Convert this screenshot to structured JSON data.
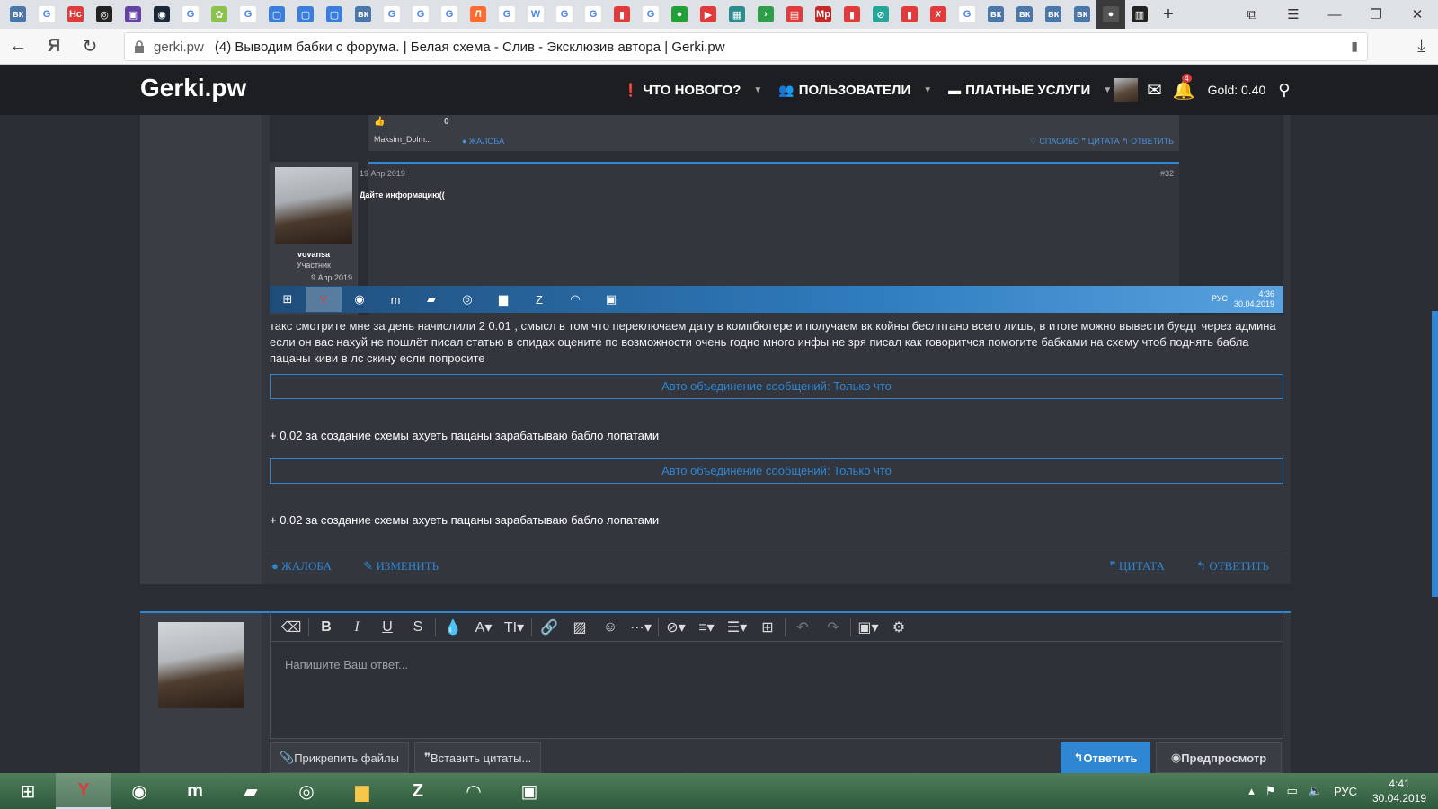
{
  "browser": {
    "tabs": [
      {
        "icon": "vk-icon",
        "glyph": "вк",
        "color": "#4a76a8"
      },
      {
        "icon": "google-icon",
        "glyph": "G",
        "color": "#ffffff"
      },
      {
        "icon": "hc-icon",
        "glyph": "Hc",
        "color": "#e03a3a"
      },
      {
        "icon": "instagram-icon",
        "glyph": "◎",
        "color": "#222222"
      },
      {
        "icon": "twitch-icon",
        "glyph": "▣",
        "color": "#6441a5"
      },
      {
        "icon": "steam-icon",
        "glyph": "◉",
        "color": "#1b2838"
      },
      {
        "icon": "google-icon",
        "glyph": "G",
        "color": "#ffffff"
      },
      {
        "icon": "flower-icon",
        "glyph": "✿",
        "color": "#8bc34a"
      },
      {
        "icon": "google-icon",
        "glyph": "G",
        "color": "#ffffff"
      },
      {
        "icon": "chat-icon",
        "glyph": "▢",
        "color": "#3b7ddd"
      },
      {
        "icon": "chat-icon",
        "glyph": "▢",
        "color": "#3b7ddd"
      },
      {
        "icon": "chat-icon",
        "glyph": "▢",
        "color": "#3b7ddd"
      },
      {
        "icon": "vk-icon",
        "glyph": "вк",
        "color": "#4a76a8"
      },
      {
        "icon": "google-icon",
        "glyph": "G",
        "color": "#ffffff"
      },
      {
        "icon": "google-icon",
        "glyph": "G",
        "color": "#ffffff"
      },
      {
        "icon": "google-icon",
        "glyph": "G",
        "color": "#ffffff"
      },
      {
        "icon": "letter-l-icon",
        "glyph": "Л",
        "color": "#ff6a2f"
      },
      {
        "icon": "google-icon",
        "glyph": "G",
        "color": "#ffffff"
      },
      {
        "icon": "wikipedia-icon",
        "glyph": "W",
        "color": "#ffffff"
      },
      {
        "icon": "google-icon",
        "glyph": "G",
        "color": "#ffffff"
      },
      {
        "icon": "google-icon",
        "glyph": "G",
        "color": "#ffffff"
      },
      {
        "icon": "red-square-icon",
        "glyph": "▮",
        "color": "#e03a3a"
      },
      {
        "icon": "google-icon",
        "glyph": "G",
        "color": "#ffffff"
      },
      {
        "icon": "sberbank-icon",
        "glyph": "●",
        "color": "#21a038"
      },
      {
        "icon": "youtube-icon",
        "glyph": "▶",
        "color": "#e03a3a"
      },
      {
        "icon": "museum-icon",
        "glyph": "▦",
        "color": "#2a8c8c"
      },
      {
        "icon": "arrow-icon",
        "glyph": "›",
        "color": "#2e9e4a"
      },
      {
        "icon": "news-icon",
        "glyph": "▤",
        "color": "#e03a3a"
      },
      {
        "icon": "mr-icon",
        "glyph": "Mp",
        "color": "#c62828"
      },
      {
        "icon": "red-square-icon",
        "glyph": "▮",
        "color": "#e03a3a"
      },
      {
        "icon": "compass-icon",
        "glyph": "⊘",
        "color": "#26a69a"
      },
      {
        "icon": "red-square-icon",
        "glyph": "▮",
        "color": "#e03a3a"
      },
      {
        "icon": "slash-icon",
        "glyph": "✗",
        "color": "#e03a3a"
      },
      {
        "icon": "google-icon",
        "glyph": "G",
        "color": "#ffffff"
      },
      {
        "icon": "vk-icon",
        "glyph": "вк",
        "color": "#4a76a8"
      },
      {
        "icon": "vk-icon",
        "glyph": "вк",
        "color": "#4a76a8"
      },
      {
        "icon": "vk-icon",
        "glyph": "вк",
        "color": "#4a76a8"
      },
      {
        "icon": "vk-icon",
        "glyph": "вк",
        "color": "#4a76a8"
      },
      {
        "icon": "gerki-icon",
        "glyph": "●",
        "color": "#555555"
      },
      {
        "icon": "chart-icon",
        "glyph": "▥",
        "color": "#222222"
      }
    ],
    "new_tab": "+",
    "url_domain": "gerki.pw",
    "page_title": "(4) Выводим бабки с форума. | Белая схема - Слив - Эксклюзив автора | Gerki.pw"
  },
  "site": {
    "logo": "Gerki.pw",
    "nav": [
      {
        "label": "ЧТО НОВОГО?",
        "icon": "alert-icon",
        "glyph": "❗"
      },
      {
        "label": "ПОЛЬЗОВАТЕЛИ",
        "icon": "users-icon",
        "glyph": "👥"
      },
      {
        "label": "ПЛАТНЫЕ УСЛУГИ",
        "icon": "folder-icon",
        "glyph": "▬"
      }
    ],
    "notif_count": "4",
    "gold": "Gold: 0.40"
  },
  "shot": {
    "like_count": "0",
    "prev_user": "Maksim_Dolm...",
    "prev_report": "● ЖАЛОБА",
    "prev_actions": "♡ СПАСИБО   ❞ ЦИТАТА   ↰ ОТВЕТИТЬ",
    "date": "19 Апр 2019",
    "post_num": "#32",
    "post_text": "Дайте информацию((",
    "username": "vovansa",
    "role": "Участник",
    "joined": "9 Апр 2019",
    "lang": "РУС",
    "time": "4:36",
    "day": "30.04.2019"
  },
  "post": {
    "body": "такс смотрите мне за день начислили 2 0.01 , смысл в том что переключаем дату в компбютере и получаем вк койны беслптано всего лишь, в итоге можно вывести буедт через админа если он вас нахуй не пошлёт писал статью в спидах оцените по возможности очень годно много инфы не зря писал как говоритчся помогите бабками на схему чтоб поднять бабла пацаны киви в лс скину если попросите",
    "merge_label": "Авто объединение сообщений: Только что",
    "bonus": "+ 0.02 за создание схемы ахуеть пацаны зарабатываю бабло лопатами",
    "report": "ЖАЛОБА",
    "edit": "ИЗМЕНИТЬ",
    "quote": "ЦИТАТА",
    "reply": "ОТВЕТИТЬ"
  },
  "editor": {
    "placeholder": "Напишите Ваш ответ...",
    "attach": "Прикрепить файлы",
    "insert_quotes": "Вставить цитаты...",
    "submit": "Ответить",
    "preview": "Предпросмотр"
  },
  "taskbar": {
    "lang": "РУС",
    "time": "4:41",
    "date": "30.04.2019"
  }
}
